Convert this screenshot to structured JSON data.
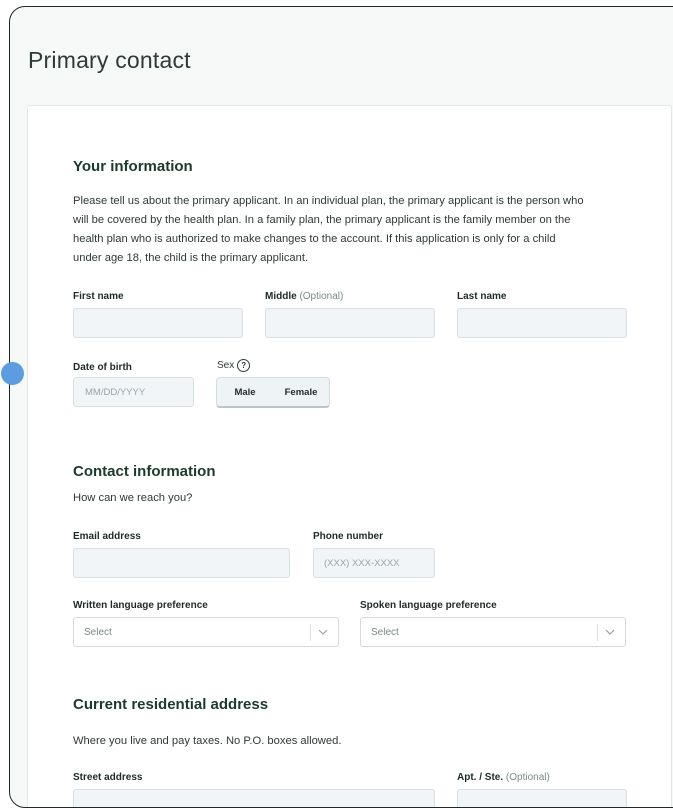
{
  "page": {
    "title": "Primary contact"
  },
  "your_information": {
    "heading": "Your information",
    "description_lines": [
      "Please tell us about the primary applicant. In an individual plan, the primary applicant is the person who",
      "will be covered by the health plan. In a family plan, the primary applicant is the family member on the",
      "health plan who is authorized to make changes to the account. If this application is only for a child",
      "under age 18, the child is the primary applicant."
    ],
    "first_name": {
      "label": "First name",
      "value": ""
    },
    "middle": {
      "label": "Middle",
      "optional": "(Optional)",
      "value": ""
    },
    "last_name": {
      "label": "Last name",
      "value": ""
    },
    "date_of_birth": {
      "label": "Date of birth",
      "placeholder": "MM/DD/YYYY"
    },
    "sex": {
      "label": "Sex",
      "help_icon": "question-circle-icon",
      "help_glyph": "?",
      "options": [
        "Male",
        "Female"
      ]
    }
  },
  "contact_information": {
    "heading": "Contact information",
    "subtext": "How can we reach you?",
    "email": {
      "label": "Email address",
      "value": ""
    },
    "phone": {
      "label": "Phone number",
      "placeholder": "(XXX) XXX-XXXX"
    },
    "written_language": {
      "label": "Written language preference",
      "value": "Select",
      "icon": "chevron-down-icon"
    },
    "spoken_language": {
      "label": "Spoken language preference",
      "value": "Select",
      "icon": "chevron-down-icon"
    }
  },
  "residential_address": {
    "heading": "Current residential address",
    "subtext": "Where you live and pay taxes. No P.O. boxes allowed.",
    "street": {
      "label": "Street address"
    },
    "apt": {
      "label": "Apt. / Ste.",
      "optional": "(Optional)"
    }
  },
  "colors": {
    "heading": "#1c3a2c",
    "input_bg": "#f1f5f7",
    "marker": "#5b9ddf"
  }
}
